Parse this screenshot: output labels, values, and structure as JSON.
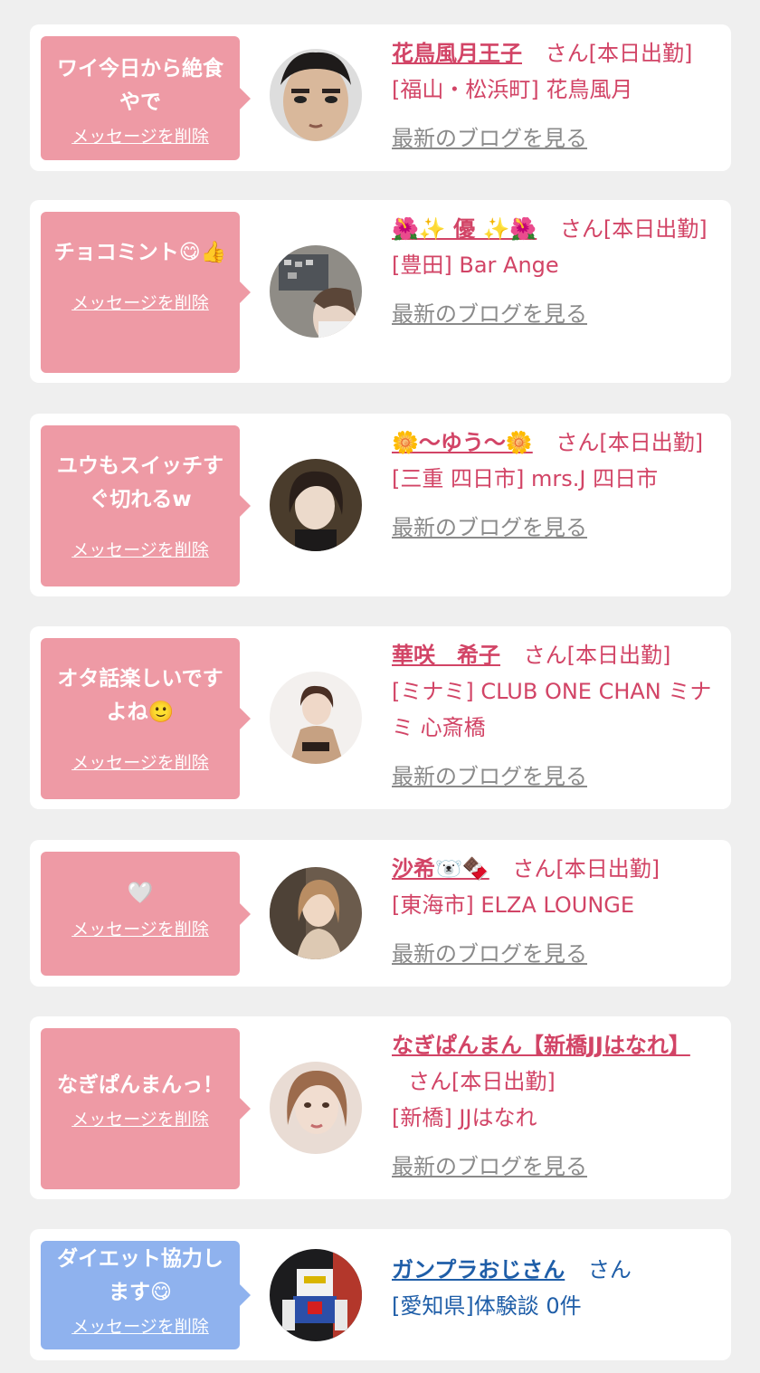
{
  "items": [
    {
      "message": "ワイ今日から絶食やで",
      "delete_label": "メッセージを削除",
      "name": "花鳥風月王子",
      "suffix": "さん[本日出勤]",
      "location": "[福山・松浜町] 花鳥風月",
      "blog_label": "最新のブログを見る",
      "theme": "pink"
    },
    {
      "message": "チョコミント",
      "message_emoji": "😋👍",
      "delete_label": "メッセージを削除",
      "name": "🌺✨ 優 ✨🌺",
      "suffix": "さん[本日出勤]",
      "location": "[豊田] Bar Ange",
      "blog_label": "最新のブログを見る",
      "theme": "pink"
    },
    {
      "message": "ユウもスイッチすぐ切れるw",
      "delete_label": "メッセージを削除",
      "name": "🌼〜ゆう〜🌼",
      "suffix": "さん[本日出勤]",
      "location": "[三重 四日市] mrs.J 四日市",
      "blog_label": "最新のブログを見る",
      "theme": "pink"
    },
    {
      "message": "オタ話楽しいですよね",
      "message_emoji": "🙂",
      "delete_label": "メッセージを削除",
      "name": "華咲　希子",
      "suffix": "さん[本日出勤]",
      "location": "[ミナミ] CLUB ONE CHAN ミナミ 心斎橋",
      "blog_label": "最新のブログを見る",
      "theme": "pink"
    },
    {
      "message": "",
      "message_emoji": "🤍",
      "delete_label": "メッセージを削除",
      "name": "沙希🐻‍❄️🍫",
      "suffix": "さん[本日出勤]",
      "location": "[東海市] ELZA LOUNGE",
      "blog_label": "最新のブログを見る",
      "theme": "pink"
    },
    {
      "message": "なぎぱんまんっ！",
      "delete_label": "メッセージを削除",
      "name": "なぎぱんまん【新橋JJはなれ】",
      "suffix": "さん[本日出勤]",
      "location": "[新橋] JJはなれ",
      "blog_label": "最新のブログを見る",
      "theme": "pink"
    },
    {
      "message": "ダイエット協力します",
      "message_emoji": "😋",
      "delete_label": "メッセージを削除",
      "name": "ガンプラおじさん",
      "suffix": "さん",
      "location": "[愛知県]体験談 0件",
      "theme": "blue"
    }
  ],
  "colors": {
    "pink": "#ee9aa5",
    "blue": "#8fb2ee",
    "name_pink": "#d24466",
    "name_blue": "#1f5ea8",
    "grey_link": "#8a8a8a"
  }
}
